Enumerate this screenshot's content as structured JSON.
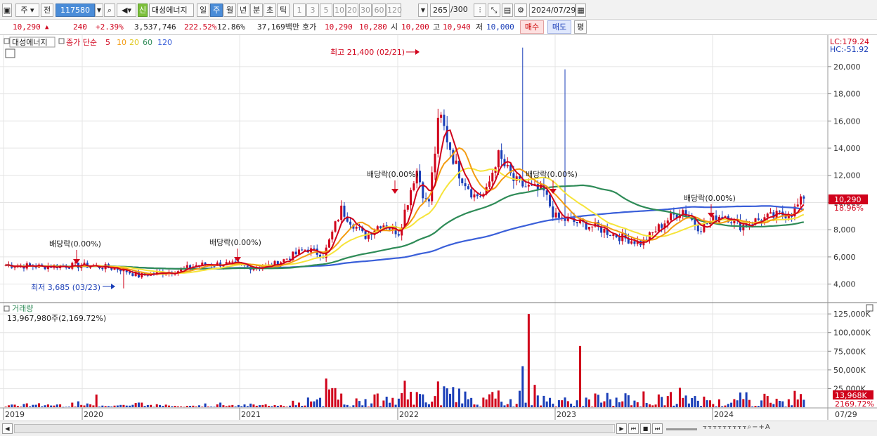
{
  "toolbar": {
    "stock_type": "주",
    "prev": "전",
    "code": "117580",
    "new_badge": "신",
    "name": "대성에너지",
    "periods": [
      "일",
      "주",
      "월",
      "년",
      "분",
      "초",
      "틱"
    ],
    "active_period": "주",
    "minutes": [
      "1",
      "3",
      "5",
      "10",
      "20",
      "30",
      "60",
      "120"
    ],
    "count": "265",
    "count_max": "/300",
    "date": "2024/07/29"
  },
  "quote": {
    "price": "10,290",
    "change": "240",
    "change_pct": "+2.39%",
    "volume": "3,537,746",
    "vol_ratio": "222.52%",
    "turnover": "12.86%",
    "amount": "37,169백만",
    "bid_label": "호가",
    "bid1": "10,290",
    "bid2": "10,280",
    "open_label": "시",
    "open": "10,200",
    "high_label": "고",
    "high": "10,940",
    "low_label": "저",
    "low": "10,000",
    "buy": "매수",
    "sell": "매도",
    "avg": "평"
  },
  "legend": {
    "name": "대성에너지",
    "ma_label": "종가 단순",
    "ma": [
      "5",
      "10",
      "20",
      "60",
      "120"
    ]
  },
  "colors": {
    "up": "#d0021b",
    "down": "#1b3fb8",
    "ma5": "#d0021b",
    "ma10": "#f39c12",
    "ma20": "#f6e43a",
    "ma60": "#2e8b57",
    "ma120": "#3a5fd9"
  },
  "right_info": {
    "lc": "LC:179.24",
    "hc": "HC:-51.92"
  },
  "price_tag": "10,290",
  "pct_tag": "18.96%",
  "vol_tag": "13,968K",
  "vol_pct_tag": "2169.72%",
  "annotations": {
    "high": "최고 21,400 (02/21)",
    "low": "최저 3,685 (03/23)",
    "div": [
      "배당락(0.00%)",
      "배당락(0.00%)",
      "배당락(0.00%)",
      "배당락(0.00%)",
      "배당락(0.00%)"
    ]
  },
  "volume_pane": {
    "title": "거래량",
    "value": "13,967,980주(2,169.72%)"
  },
  "chart_data": {
    "type": "candlestick",
    "x_labels": [
      "2019",
      "2020",
      "2021",
      "2022",
      "2023",
      "2024",
      "07/29"
    ],
    "price_axis": [
      "20,000",
      "18,000",
      "16,000",
      "14,000",
      "12,000",
      "10,000",
      "8,000",
      "6,000",
      "4,000"
    ],
    "price_ylim": [
      3000,
      21800
    ],
    "volume_axis": [
      "125,000K",
      "100,000K",
      "75,000K",
      "50,000K",
      "25,000K"
    ],
    "close_path": [
      [
        0,
        5400
      ],
      [
        0.06,
        5300
      ],
      [
        0.1,
        5350
      ],
      [
        0.14,
        5350
      ],
      [
        0.17,
        5250
      ],
      [
        0.2,
        5100
      ],
      [
        0.23,
        4600
      ],
      [
        0.24,
        4700
      ],
      [
        0.3,
        5000
      ],
      [
        0.33,
        5400
      ],
      [
        0.38,
        5500
      ],
      [
        0.42,
        5250
      ],
      [
        0.46,
        5350
      ],
      [
        0.52,
        6600
      ],
      [
        0.55,
        6100
      ],
      [
        0.58,
        9500
      ],
      [
        0.62,
        7500
      ],
      [
        0.65,
        8500
      ],
      [
        0.68,
        7800
      ],
      [
        0.71,
        12500
      ],
      [
        0.73,
        9500
      ],
      [
        0.75,
        16500
      ],
      [
        0.78,
        12500
      ],
      [
        0.81,
        10500
      ],
      [
        0.83,
        10600
      ],
      [
        0.85,
        13500
      ],
      [
        0.88,
        11500
      ],
      [
        0.91,
        11000
      ],
      [
        0.93,
        10800
      ],
      [
        0.95,
        8900
      ],
      [
        0.98,
        8600
      ],
      [
        1.02,
        8200
      ],
      [
        1.06,
        7500
      ],
      [
        1.1,
        7000
      ],
      [
        1.14,
        8600
      ],
      [
        1.17,
        9500
      ],
      [
        1.2,
        8100
      ],
      [
        1.24,
        9200
      ],
      [
        1.27,
        8300
      ],
      [
        1.3,
        8700
      ],
      [
        1.33,
        9000
      ],
      [
        1.36,
        9300
      ],
      [
        1.38,
        10290
      ]
    ]
  }
}
